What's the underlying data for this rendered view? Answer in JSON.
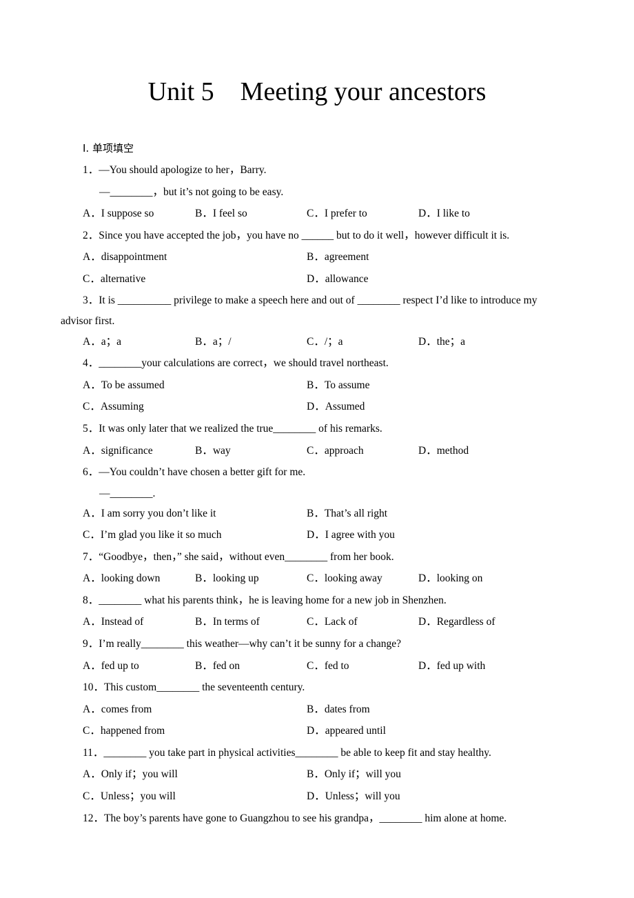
{
  "document": {
    "title": "Unit 5    Meeting your ancestors",
    "section_heading": "I. 单项填空",
    "questions": [
      {
        "stem": "1．—You should apologize to her，Barry.",
        "stem2": "—________，but it’s not going to be easy.",
        "options": [
          "A．I suppose so",
          "B．I feel so",
          "C．I prefer to",
          "D．I like to"
        ]
      },
      {
        "stem": "2．Since you have accepted the job，you have no ______ but to do it well，however difficult it is.",
        "options": [
          "A．disappointment",
          "B．agreement",
          "C．alternative",
          "D．allowance"
        ]
      },
      {
        "stem": "3．It is __________ privilege to make a speech here and out of ________ respect I’d like to introduce my",
        "stem2": "advisor first.",
        "options": [
          "A．a；a",
          "B．a；/",
          "C．/；a",
          "D．the；a"
        ]
      },
      {
        "stem": "4．________your calculations are correct，we should travel northeast.",
        "options": [
          "A．To be assumed",
          "B．To assume",
          "C．Assuming",
          "D．Assumed"
        ]
      },
      {
        "stem": "5．It was only later that we realized the true________ of his remarks.",
        "options": [
          "A．significance",
          "B．way",
          "C．approach",
          "D．method"
        ]
      },
      {
        "stem": "6．—You couldn’t have chosen a better gift for me.",
        "stem2": "—________.",
        "options": [
          "A．I am sorry you don’t like it",
          "B．That’s all right",
          "C．I’m glad you like it so much",
          "D．I agree with you"
        ]
      },
      {
        "stem": "7．“Goodbye，then，” she said，without even________ from her book.",
        "options": [
          "A．looking down",
          "B．looking up",
          "C．looking away",
          "D．looking on"
        ]
      },
      {
        "stem": "8．________ what his parents think，he is leaving home for a new job in Shenzhen.",
        "options": [
          "A．Instead of",
          "B．In terms of",
          "C．Lack of",
          "D．Regardless of"
        ]
      },
      {
        "stem": "9．I’m really________ this weather—why can’t it be sunny for a change?",
        "options": [
          "A．fed up to",
          "B．fed on",
          "C．fed to",
          "D．fed up with"
        ]
      },
      {
        "stem": "10．This custom________ the seventeenth century.",
        "options": [
          "A．comes from",
          "B．dates from",
          "C．happened from",
          "D．appeared until"
        ]
      },
      {
        "stem": "11．________ you take part in physical activities________ be able to keep fit and stay healthy.",
        "options": [
          "A．Only if；you will",
          "B．Only if；will you",
          "C．Unless；you will",
          "D．Unless；will you"
        ]
      },
      {
        "stem": "12．The boy’s parents have gone to Guangzhou to see his grandpa，________ him alone at home."
      }
    ]
  }
}
